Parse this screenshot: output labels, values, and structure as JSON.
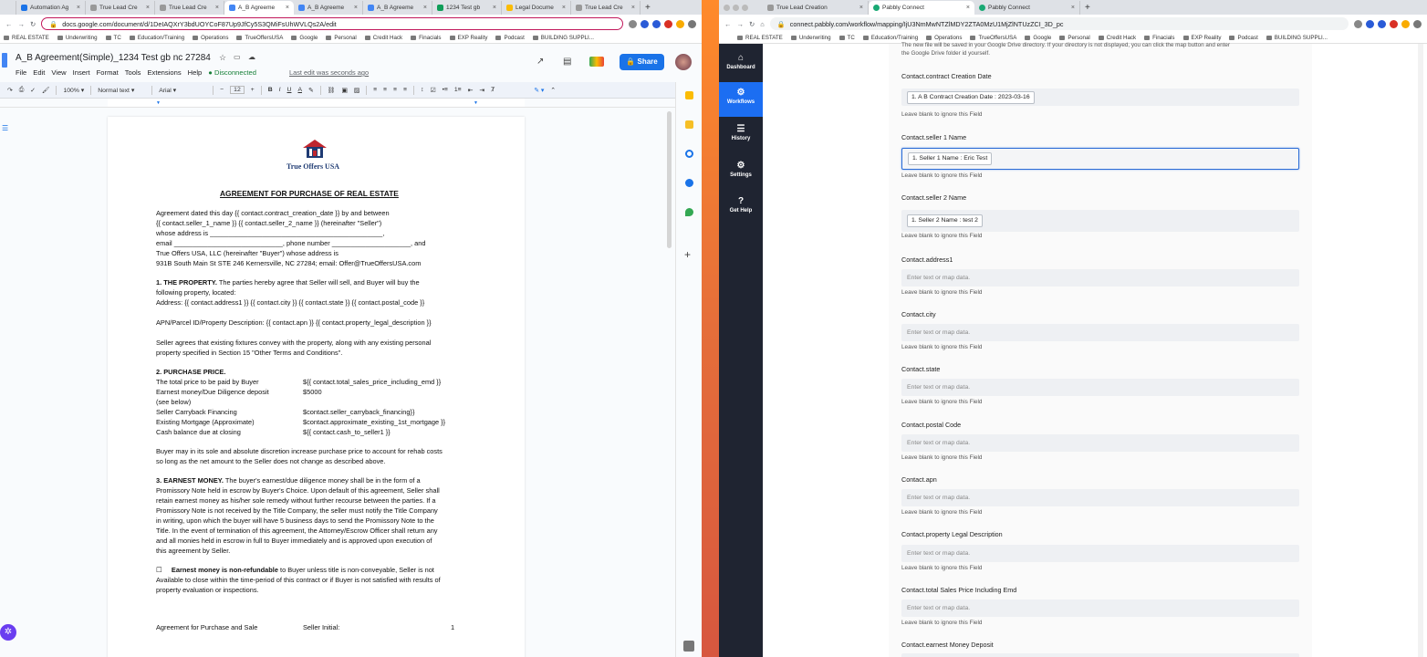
{
  "left_browser": {
    "tabs": [
      {
        "label": "Automation Ag"
      },
      {
        "label": "True Lead Cre"
      },
      {
        "label": "True Lead Cre"
      },
      {
        "label": "A_B Agreeme"
      },
      {
        "label": "A_B Agreeme"
      },
      {
        "label": "A_B Agreeme"
      },
      {
        "label": "1234 Test gb"
      },
      {
        "label": "Legal Docume"
      },
      {
        "label": "True Lead Cre"
      }
    ],
    "url": "docs.google.com/document/d/1DeIAQXrY3bdUOYCoF87Up9JfCy5S3QMiFsUhWVLQs2A/edit",
    "bookmarks": [
      "REAL ESTATE",
      "Underwriting",
      "TC",
      "Education/Training",
      "Operations",
      "TrueOffersUSA",
      "Google",
      "Personal",
      "Credit Hack",
      "Finacials",
      "EXP Reality",
      "Podcast",
      "BUILDING SUPPLI..."
    ]
  },
  "docs": {
    "title": "A_B Agreement(Simple)_1234 Test gb nc 27284",
    "menu": [
      "File",
      "Edit",
      "View",
      "Insert",
      "Format",
      "Tools",
      "Extensions",
      "Help"
    ],
    "status": "Disconnected",
    "last_edit": "Last edit was seconds ago",
    "share_label": "Share",
    "zoom": "100%",
    "style": "Normal text",
    "font": "Arial",
    "font_size": "12"
  },
  "document": {
    "logo_text": "True Offers USA",
    "heading": "AGREEMENT FOR PURCHASE OF REAL ESTATE",
    "lines": [
      "Agreement dated this day {{ contact.contract_creation_date }}                by and between",
      "{{ contact.seller_1_name }} {{ contact.seller_2_name }}                              (hereinafter \"Seller\")",
      "whose address is ______________________________________________,",
      "email _____________________________, phone number _____________________, and",
      "True Offers USA, LLC (hereinafter \"Buyer\") whose address is",
      "931B South Main St STE 246 Kernersville, NC 27284; email: Offer@TrueOffersUSA.com"
    ],
    "s1_title": "1. THE PROPERTY.",
    "s1_text_a": " The parties hereby agree that Seller will sell, and Buyer will buy the",
    "s1_text_b": "following property, located:",
    "s1_address": "Address: {{ contact.address1 }} {{ contact.city }} {{ contact.state }} {{ contact.postal_code }}",
    "s1_apn": "APN/Parcel ID/Property Description: {{ contact.apn }} {{ contact.property_legal_description }}",
    "s1_fixtures_a": "Seller agrees that existing fixtures convey with the property, along with any existing personal",
    "s1_fixtures_b": "property specified in Section 15 \"Other Terms and Conditions\".",
    "s2_title": "2. PURCHASE PRICE.",
    "price_rows": [
      {
        "label": "The total price to be paid by Buyer",
        "value": "${{ contact.total_sales_price_including_emd }}"
      },
      {
        "label": "Earnest money/Due Diligence deposit",
        "value": "$5000"
      },
      {
        "label": "(see below)",
        "value": ""
      },
      {
        "label": "Seller Carryback Financing",
        "value": "$contact.seller_carryback_financing}}"
      },
      {
        "label": "Existing Mortgage (Approximate)",
        "value": "$contact.approximate_existing_1st_mortgage }}"
      },
      {
        "label": "Cash balance due at closing",
        "value": "${{ contact.cash_to_seller1 }}"
      }
    ],
    "s2_note_a": "Buyer may in its sole and absolute discretion increase purchase price to account for rehab costs",
    "s2_note_b": "so long as the net amount to the Seller does not change as described above.",
    "s3_title": "3. EARNEST MONEY.",
    "s3_lines": [
      " The buyer's earnest/due diligence money shall be in the form of a",
      "Promissory Note held in escrow by Buyer's Choice. Upon default of this agreement, Seller shall",
      "retain earnest money as his/her sole remedy without further recourse between the parties. If a",
      "Promissory Note is not received by the Title Company, the seller must notify the Title Company",
      "in writing, upon which the buyer will have 5 business days to send the Promissory Note to the",
      "Title. In the event of termination of this agreement, the Attorney/Escrow Officer shall return any",
      "and all monies held in escrow in full to Buyer immediately and is approved upon execution of",
      "this agreement by Seller."
    ],
    "em_bold": "Earnest money is non-refundable",
    "em_rest": " to Buyer unless title is non-conveyable, Seller is not",
    "em_b": "Available to close within the time-period of this contract or if Buyer is not satisfied with results of",
    "em_c": "property evaluation or inspections.",
    "footer_left": "Agreement for Purchase and Sale",
    "footer_mid": "Seller Initial:",
    "footer_page": "1"
  },
  "right_browser": {
    "tabs": [
      {
        "label": "True Lead Creation"
      },
      {
        "label": "Pabbly Connect"
      },
      {
        "label": "Pabbly Connect"
      }
    ],
    "url": "connect.pabbly.com/workflow/mapping/IjU3NmMwNTZlMDY2ZTA0MzU1MjZlNTUzZCI_3D_pc",
    "bookmarks": [
      "REAL ESTATE",
      "Underwriting",
      "TC",
      "Education/Training",
      "Operations",
      "TrueOffersUSA",
      "Google",
      "Personal",
      "Credit Hack",
      "Finacials",
      "EXP Reality",
      "Podcast",
      "BUILDING SUPPLI..."
    ]
  },
  "pabbly": {
    "nav": [
      {
        "label": "Dashboard",
        "icon": "⌂"
      },
      {
        "label": "Workflows",
        "icon": "⚙"
      },
      {
        "label": "History",
        "icon": "☰"
      },
      {
        "label": "Settings",
        "icon": "⚙"
      },
      {
        "label": "Get Help",
        "icon": "?"
      }
    ],
    "top_note_a": "The new file will be saved in your Google Drive directory. If your directory is not displayed, you can click the map button and enter",
    "top_note_b": "the Google Drive folder id yourself.",
    "hint": "Leave blank to ignore this Field",
    "placeholder": "Enter text or map data.",
    "fields": [
      {
        "label": "Contact.contract Creation Date",
        "chip": "1. A B Contract Creation Date : 2023-03-16"
      },
      {
        "label": "Contact.seller 1 Name",
        "chip": "1. Seller 1 Name : Eric Test"
      },
      {
        "label": "Contact.seller 2 Name",
        "chip": "1. Seller 2 Name : test 2"
      },
      {
        "label": "Contact.address1",
        "chip": ""
      },
      {
        "label": "Contact.city",
        "chip": ""
      },
      {
        "label": "Contact.state",
        "chip": ""
      },
      {
        "label": "Contact.postal Code",
        "chip": ""
      },
      {
        "label": "Contact.apn",
        "chip": ""
      },
      {
        "label": "Contact.property Legal Description",
        "chip": ""
      },
      {
        "label": "Contact.total Sales Price Including Emd",
        "chip": ""
      },
      {
        "label": "Contact.earnest Money Deposit",
        "chip": ""
      }
    ]
  }
}
